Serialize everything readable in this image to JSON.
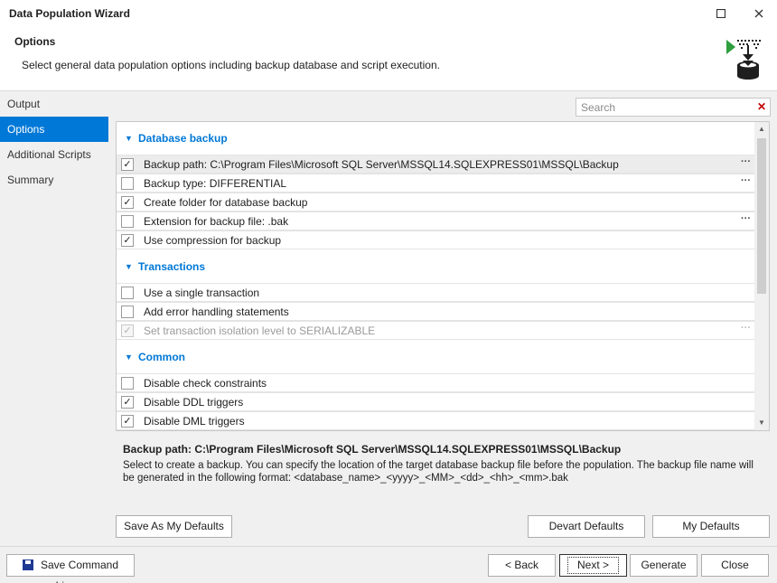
{
  "window": {
    "title": "Data Population Wizard"
  },
  "header": {
    "title": "Options",
    "description": "Select general data population options including backup database and script execution."
  },
  "sidebar": {
    "items": [
      {
        "label": "Output"
      },
      {
        "label": "Options"
      },
      {
        "label": "Additional Scripts"
      },
      {
        "label": "Summary"
      }
    ],
    "active": "Options"
  },
  "search": {
    "placeholder": "Search"
  },
  "groups": {
    "database_backup": {
      "title": "Database backup",
      "rows": [
        {
          "label": "Backup path: C:\\Program Files\\Microsoft SQL Server\\MSSQL14.SQLEXPRESS01\\MSSQL\\Backup",
          "checked": true,
          "more": "···"
        },
        {
          "label": "Backup type: DIFFERENTIAL",
          "checked": false,
          "more": "···"
        },
        {
          "label": "Create folder for database backup",
          "checked": true
        },
        {
          "label": "Extension for backup file: .bak",
          "checked": false,
          "more": "···"
        },
        {
          "label": "Use compression for backup",
          "checked": true
        }
      ]
    },
    "transactions": {
      "title": "Transactions",
      "rows": [
        {
          "label": "Use a single transaction",
          "checked": false
        },
        {
          "label": "Add error handling statements",
          "checked": false
        },
        {
          "label": "Set transaction isolation level to SERIALIZABLE",
          "checked": true,
          "disabled": true,
          "more": "···"
        }
      ]
    },
    "common": {
      "title": "Common",
      "rows": [
        {
          "label": "Disable check constraints",
          "checked": false
        },
        {
          "label": "Disable DDL triggers",
          "checked": true
        },
        {
          "label": "Disable DML triggers",
          "checked": true
        }
      ]
    }
  },
  "check_mark": "✓",
  "description": {
    "title": "Backup path: C:\\Program Files\\Microsoft SQL Server\\MSSQL14.SQLEXPRESS01\\MSSQL\\Backup",
    "text": "Select to create a backup. You can specify the location of the target database backup file before the population. The backup file name will be generated in the following format: <database_name>_<yyyy>_<MM>_<dd>_<hh>_<mm>.bak"
  },
  "buttons": {
    "save_as_defaults": "Save As My Defaults",
    "devart_defaults": "Devart Defaults",
    "my_defaults": "My Defaults",
    "save_command_line": "Save Command Line...",
    "back": "< Back",
    "next": "Next >",
    "generate": "Generate",
    "close": "Close"
  },
  "colors": {
    "accent": "#0078d7",
    "icon_green": "#2e9e3e",
    "icon_dark": "#1e1e1e"
  }
}
